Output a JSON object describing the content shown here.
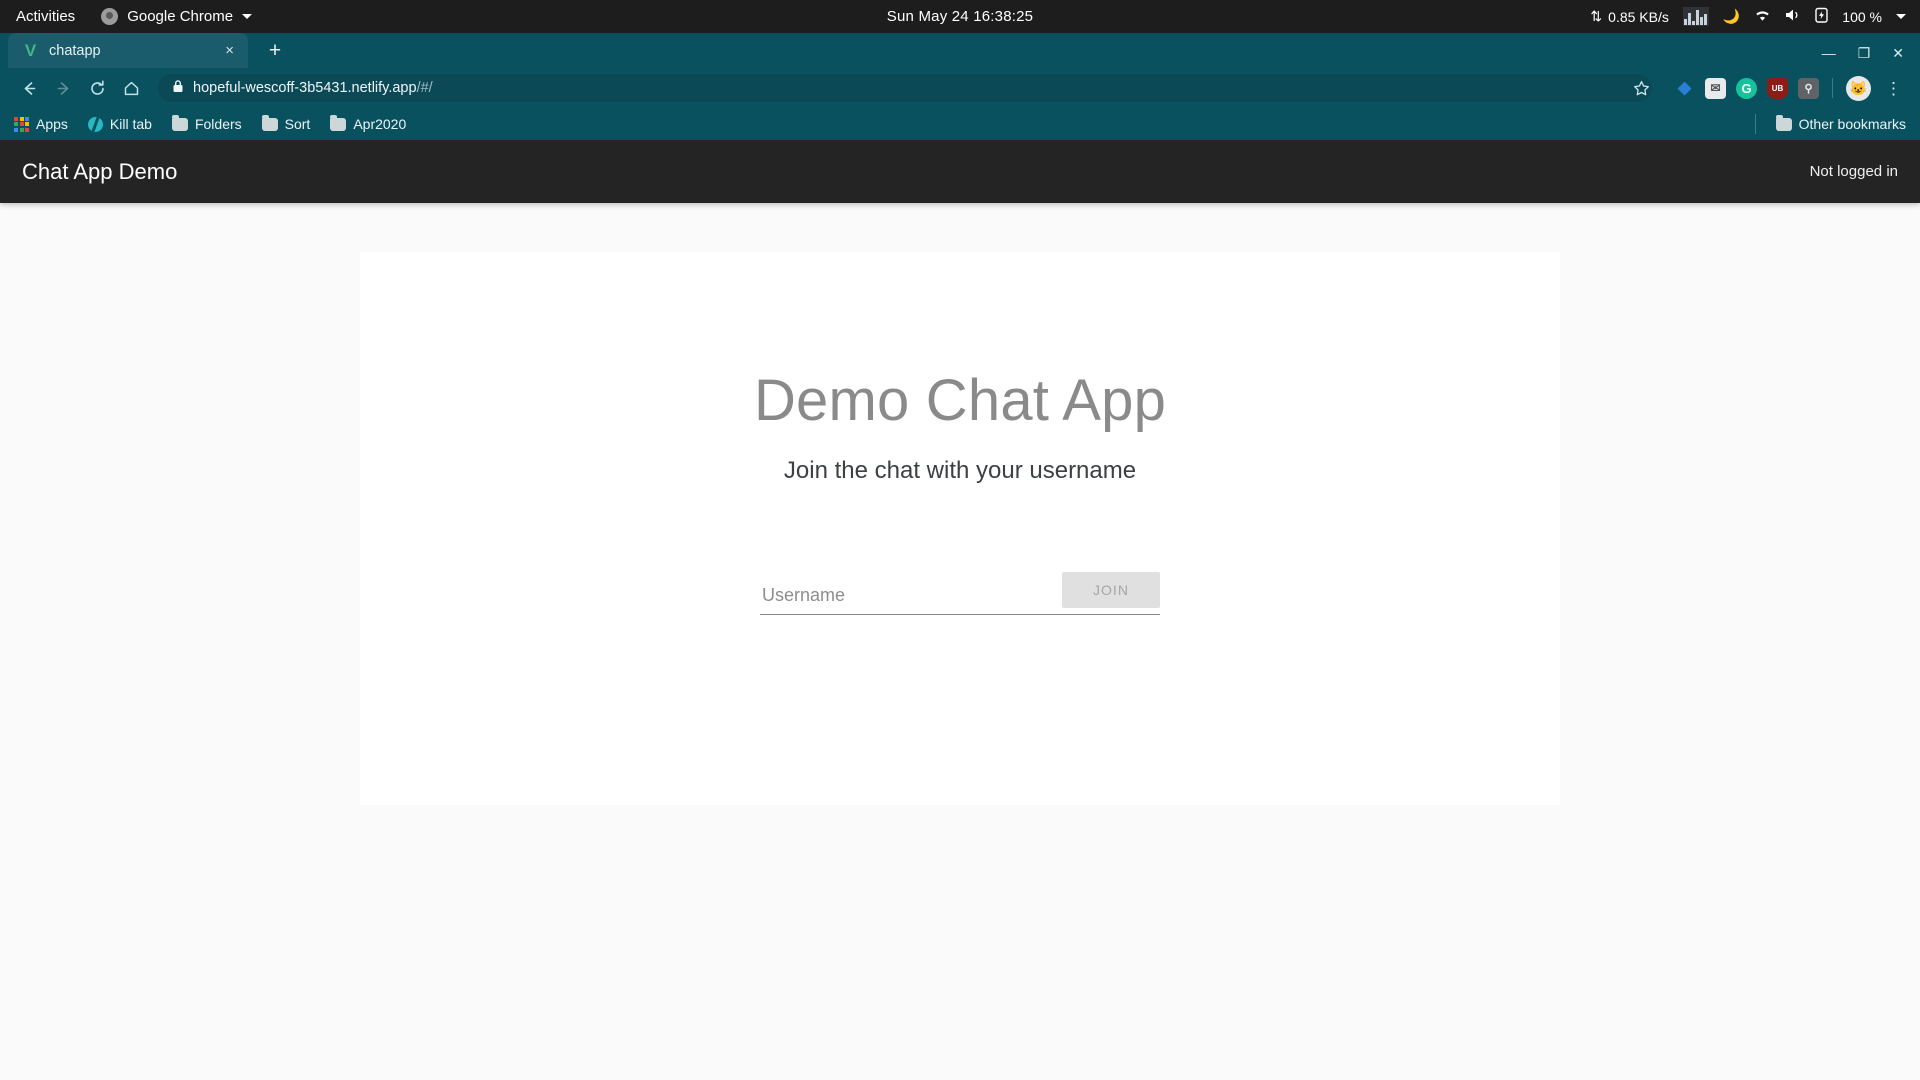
{
  "os_bar": {
    "activities": "Activities",
    "app_name": "Google Chrome",
    "app_icon": "chrome-icon",
    "clock": "Sun May 24  16:38:25",
    "network_speed": "0.85 KB/s",
    "network_icon": "updown-arrows-icon",
    "graph_icon": "system-monitor-graph-icon",
    "night_icon": "moon-icon",
    "wifi_icon": "wifi-icon",
    "volume_icon": "speaker-icon",
    "battery_icon": "battery-charging-icon",
    "battery_level": "100 %",
    "menu_caret": "chevron-down-icon"
  },
  "browser": {
    "tab": {
      "title": "chatapp",
      "favicon": "vuejs-logo-icon",
      "close_label": "×"
    },
    "newtab_label": "+",
    "window_controls": {
      "minimize": "—",
      "maximize": "❐",
      "close": "✕"
    },
    "toolbar": {
      "back_icon": "arrow-left-icon",
      "forward_icon": "arrow-right-icon",
      "reload_icon": "reload-icon",
      "home_icon": "home-icon",
      "lock_icon": "padlock-icon",
      "url_host": "hopeful-wescoff-3b5431.netlify.app",
      "url_path": "/#/",
      "url_full": "hopeful-wescoff-3b5431.netlify.app/#/",
      "star_icon": "bookmark-star-icon",
      "menu_icon": "three-dot-menu-icon",
      "profile_icon": "cat-avatar-icon",
      "extensions": [
        {
          "name": "blue-diamond-extension-icon",
          "glyph": "◆",
          "color": "#1976d2",
          "bg": "transparent"
        },
        {
          "name": "mail-extension-icon",
          "glyph": "✉",
          "color": "#555555",
          "bg": "#e8eaed"
        },
        {
          "name": "grammarly-extension-icon",
          "glyph": "G",
          "color": "#ffffff",
          "bg": "#15c39a"
        },
        {
          "name": "ublock-origin-extension-icon",
          "glyph": "UB",
          "color": "#ffffff",
          "bg": "#8d1c17"
        },
        {
          "name": "notes-extension-icon",
          "glyph": "○",
          "color": "#e8eaed",
          "bg": "#5f6368"
        }
      ]
    },
    "bookmarks": [
      {
        "label": "Apps",
        "icon": "apps-grid-icon"
      },
      {
        "label": "Kill tab",
        "icon": "globe-icon"
      },
      {
        "label": "Folders",
        "icon": "folder-icon"
      },
      {
        "label": "Sort",
        "icon": "folder-icon"
      },
      {
        "label": "Apr2020",
        "icon": "folder-icon"
      }
    ],
    "other_bookmarks": {
      "label": "Other bookmarks",
      "icon": "folder-icon"
    }
  },
  "app": {
    "header": {
      "title": "Chat App Demo",
      "status": "Not logged in"
    },
    "hero": {
      "title": "Demo Chat App",
      "subtitle": "Join the chat with your username"
    },
    "form": {
      "username_value": "",
      "username_placeholder": "Username",
      "join_label": "JOIN"
    }
  },
  "colors": {
    "chrome_chrome": "#0a5160",
    "active_tab": "#1a5c6b",
    "omnibox": "#0b4956",
    "app_header": "#242424",
    "page_bg": "#fafafa",
    "card_bg": "#ffffff",
    "hero_title": "#8a8a8a",
    "join_disabled_bg": "#e0e0e0"
  }
}
